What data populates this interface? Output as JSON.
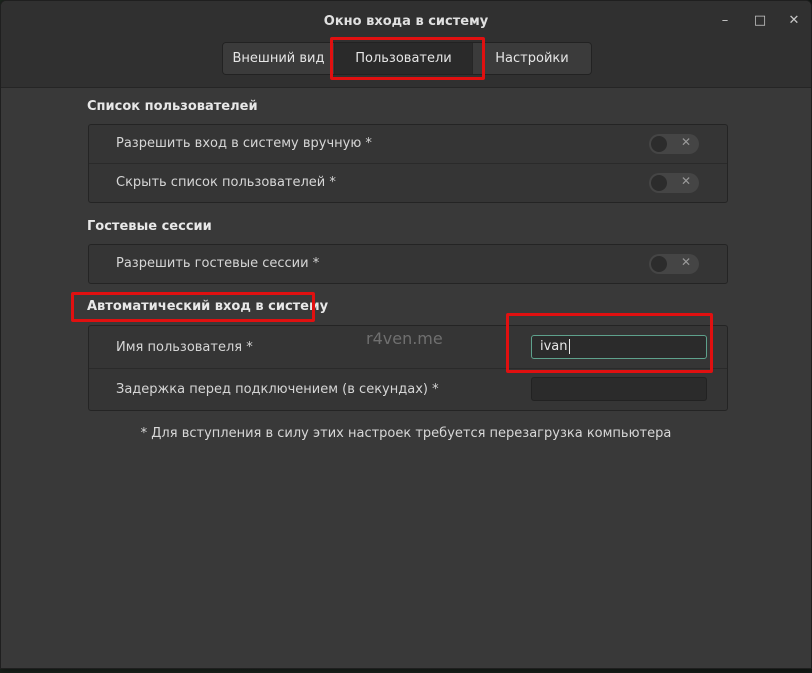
{
  "window": {
    "title": "Окно входа в систему",
    "controls": {
      "minimize": "–",
      "maximize": "□",
      "close": "✕"
    }
  },
  "tabs": [
    {
      "label": "Внешний вид",
      "active": false
    },
    {
      "label": "Пользователи",
      "active": true
    },
    {
      "label": "Настройки",
      "active": false
    }
  ],
  "users_list": {
    "title": "Список пользователей",
    "rows": [
      {
        "label": "Разрешить вход в систему вручную *",
        "toggle": "off"
      },
      {
        "label": "Скрыть список пользователей *",
        "toggle": "off"
      }
    ]
  },
  "guest_sessions": {
    "title": "Гостевые сессии",
    "rows": [
      {
        "label": "Разрешить гостевые сессии *",
        "toggle": "off"
      }
    ]
  },
  "autologin": {
    "title": "Автоматический вход в систему",
    "username_label": "Имя пользователя *",
    "username_value": "ivan",
    "delay_label": "Задержка перед подключением (в секундах) *",
    "delay_value": ""
  },
  "footer_note": "* Для вступления в силу этих настроек требуется перезагрузка компьютера",
  "watermark": "r4ven.me",
  "colors": {
    "highlight": "#e01010",
    "focus_border": "#5ea18c",
    "window_bg": "#393939"
  }
}
